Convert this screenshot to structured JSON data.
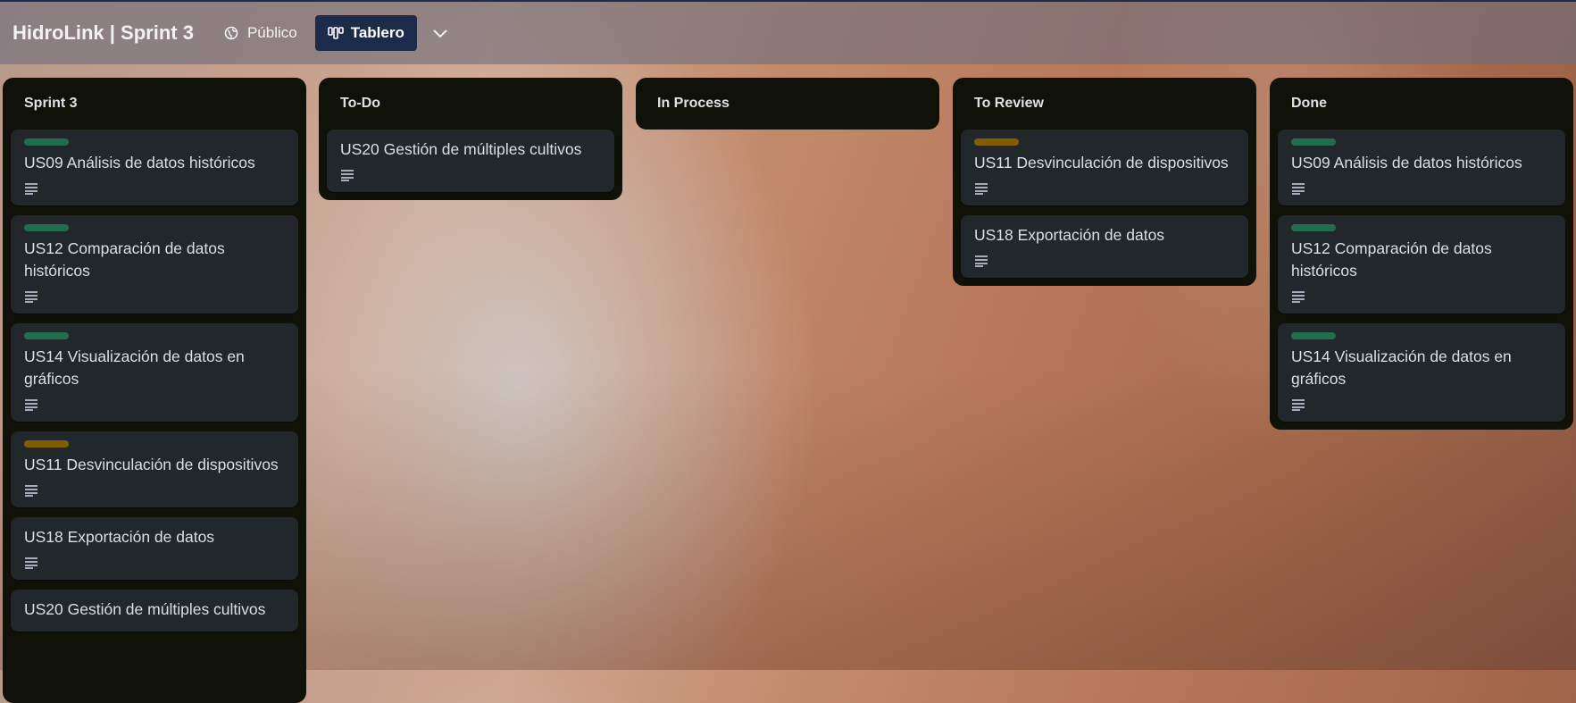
{
  "header": {
    "board_title": "HidroLink | Sprint 3",
    "visibility_label": "Público",
    "view_label": "Tablero"
  },
  "colors": {
    "label_green": "#216e4e",
    "label_yellow": "#7f5f01",
    "view_button": "#1c2b4a",
    "column_bg": "#101108",
    "card_bg": "#22272b"
  },
  "columns": [
    {
      "title": "Sprint 3",
      "cards": [
        {
          "title": "US09 Análisis de datos históricos",
          "label": "green"
        },
        {
          "title": "US12 Comparación de datos históricos",
          "label": "green"
        },
        {
          "title": "US14 Visualización de datos en gráficos",
          "label": "green"
        },
        {
          "title": "US11 Desvinculación de dispositivos",
          "label": "yellow"
        },
        {
          "title": "US18 Exportación de datos",
          "label": ""
        },
        {
          "title": "US20 Gestión de múltiples cultivos",
          "label": ""
        }
      ]
    },
    {
      "title": "To-Do",
      "cards": [
        {
          "title": "US20 Gestión de múltiples cultivos",
          "label": ""
        }
      ]
    },
    {
      "title": "In Process",
      "cards": []
    },
    {
      "title": "To Review",
      "cards": [
        {
          "title": "US11 Desvinculación de dispositivos",
          "label": "yellow"
        },
        {
          "title": "US18 Exportación de datos",
          "label": ""
        }
      ]
    },
    {
      "title": "Done",
      "cards": [
        {
          "title": "US09 Análisis de datos históricos",
          "label": "green"
        },
        {
          "title": "US12 Comparación de datos históricos",
          "label": "green"
        },
        {
          "title": "US14 Visualización de datos en gráficos",
          "label": "green"
        }
      ]
    }
  ]
}
